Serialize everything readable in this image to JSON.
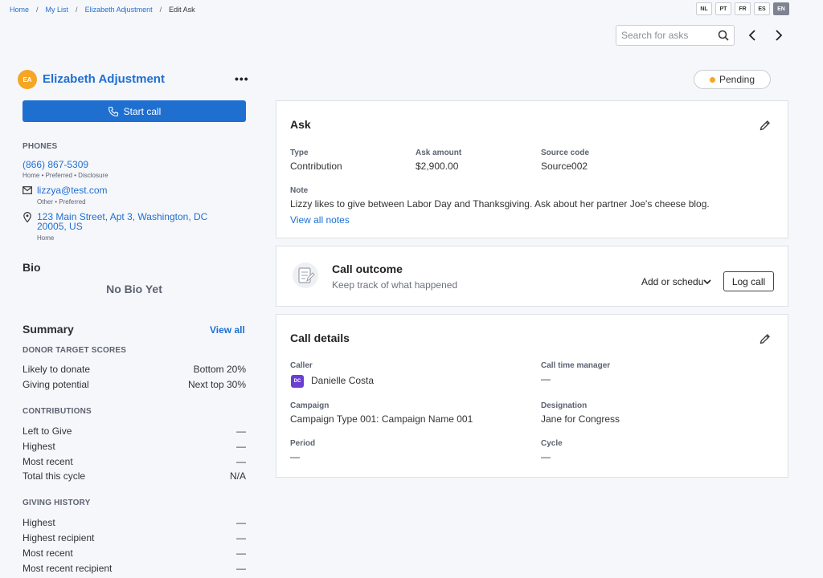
{
  "breadcrumb": [
    "Home",
    "My List",
    "Elizabeth Adjustment",
    "Edit Ask"
  ],
  "languages": [
    "NL",
    "PT",
    "FR",
    "ES",
    "EN"
  ],
  "active_language": "EN",
  "search": {
    "placeholder": "Search for asks"
  },
  "contact": {
    "initials": "EA",
    "name": "Elizabeth Adjustment",
    "more_label": "•••",
    "start_call_label": "Start call",
    "phones_label": "PHONES",
    "phone": "(866) 867-5309",
    "phone_note": "Home • Preferred • Disclosure",
    "email": "lizzya@test.com",
    "email_note": "Other • Preferred",
    "address_line1": "123 Main Street, Apt 3, Washington, DC",
    "address_line2": "20005, US",
    "address_note": "Home"
  },
  "bio": {
    "title": "Bio",
    "empty": "No Bio Yet"
  },
  "summary": {
    "title": "Summary",
    "view_all": "View all",
    "donor_scores_label": "DONOR TARGET SCORES",
    "donor_scores": [
      {
        "label": "Likely to donate",
        "value": "Bottom 20%"
      },
      {
        "label": "Giving potential",
        "value": "Next top 30%"
      }
    ],
    "contributions_label": "CONTRIBUTIONS",
    "contributions": [
      {
        "label": "Left to Give",
        "value": "—"
      },
      {
        "label": "Highest",
        "value": "—"
      },
      {
        "label": "Most recent",
        "value": "—"
      },
      {
        "label": "Total this cycle",
        "value": "N/A"
      }
    ],
    "history_label": "GIVING HISTORY",
    "history": [
      {
        "label": "Highest",
        "value": "—"
      },
      {
        "label": "Highest recipient",
        "value": "—"
      },
      {
        "label": "Most recent",
        "value": "—"
      },
      {
        "label": "Most recent recipient",
        "value": "—"
      }
    ]
  },
  "status": {
    "label": "Pending",
    "color": "#f5a623"
  },
  "ask": {
    "title": "Ask",
    "type_label": "Type",
    "type_value": "Contribution",
    "amount_label": "Ask amount",
    "amount_value": "$2,900.00",
    "source_label": "Source code",
    "source_value": "Source002",
    "note_label": "Note",
    "note_value": "Lizzy likes to give between Labor Day and Thanksgiving. Ask about her partner Joe's cheese blog.",
    "view_notes": "View all notes"
  },
  "outcome": {
    "title": "Call outcome",
    "subtitle": "Keep track of what happened",
    "schedule_label": "Add or schedu",
    "log_label": "Log call"
  },
  "details": {
    "title": "Call details",
    "caller_label": "Caller",
    "caller_initials": "DC",
    "caller_value": "Danielle Costa",
    "manager_label": "Call time manager",
    "manager_value": "—",
    "campaign_label": "Campaign",
    "campaign_value": "Campaign Type 001: Campaign Name 001",
    "designation_label": "Designation",
    "designation_value": "Jane for Congress",
    "period_label": "Period",
    "period_value": "—",
    "cycle_label": "Cycle",
    "cycle_value": "—"
  },
  "colors": {
    "accent": "#1f6fd1",
    "avatar": "#f5a623",
    "caller_badge": "#6a3fd1"
  }
}
